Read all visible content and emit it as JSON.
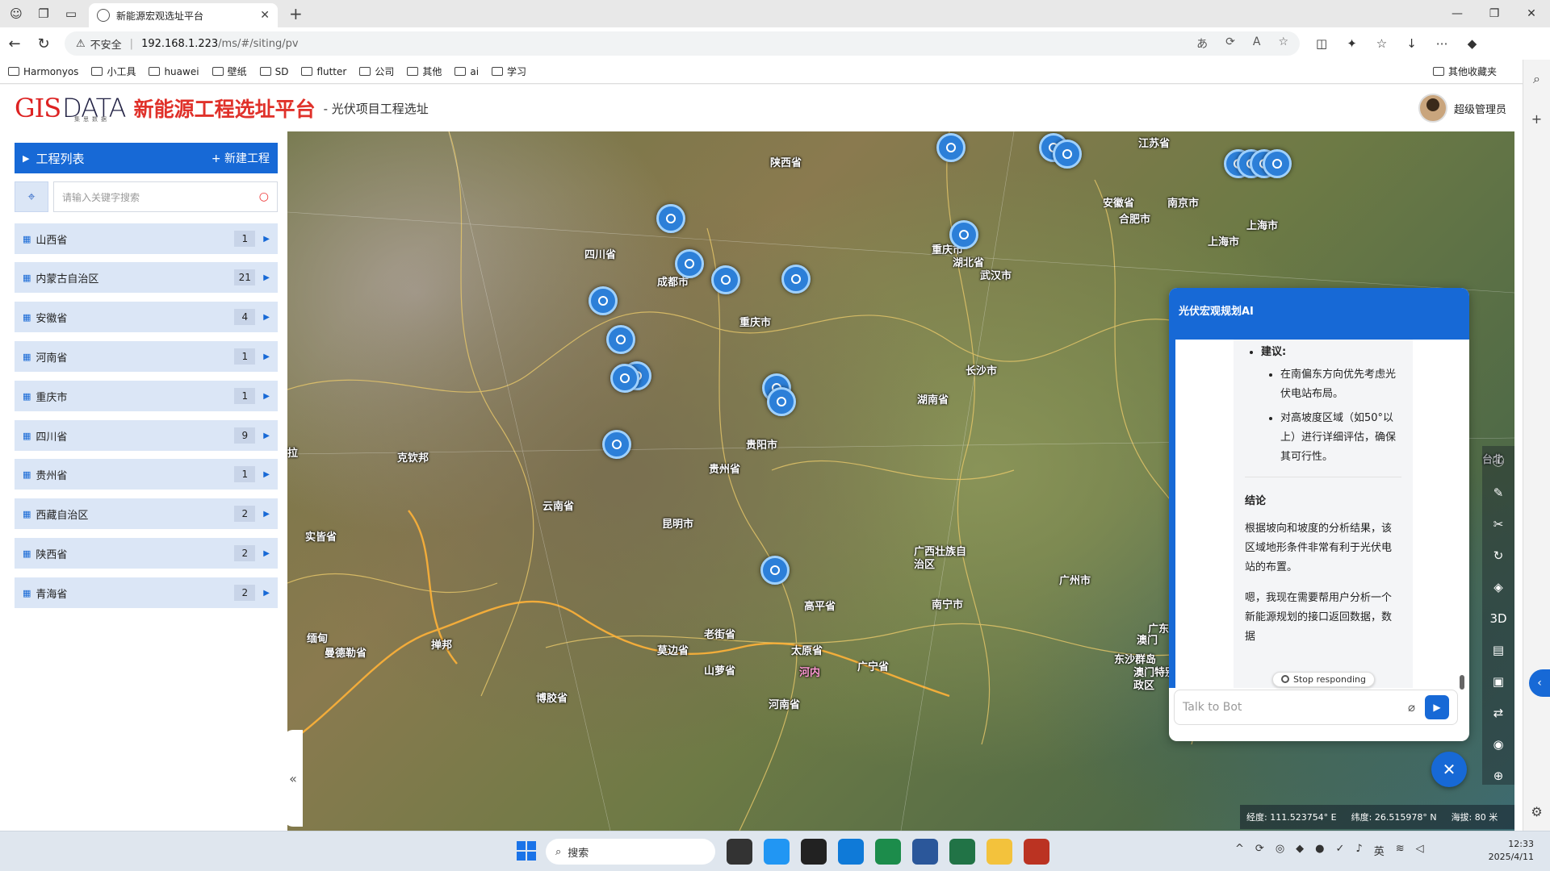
{
  "browser": {
    "tab_title": "新能源宏观选址平台",
    "security_label": "不安全",
    "url_host": "192.168.1.223",
    "url_path": "/ms/#/siting/pv",
    "bookmarks": [
      "Harmonyos",
      "小工具",
      "huawei",
      "壁纸",
      "SD",
      "flutter",
      "公司",
      "其他",
      "ai",
      "学习"
    ],
    "other_bookmarks": "其他收藏夹"
  },
  "header": {
    "logo_gis": "GIS",
    "logo_data": "DATA",
    "logo_sub": "集思数据",
    "platform_title": "新能源工程选址平台",
    "subtitle": "- 光伏项目工程选址",
    "user_name": "超级管理员"
  },
  "sidebar": {
    "list_title": "工程列表",
    "new_project": "+ 新建工程",
    "search_placeholder": "请输入关键字搜索",
    "provinces": [
      {
        "name": "山西省",
        "count": "1"
      },
      {
        "name": "内蒙古自治区",
        "count": "21"
      },
      {
        "name": "安徽省",
        "count": "4"
      },
      {
        "name": "河南省",
        "count": "1"
      },
      {
        "name": "重庆市",
        "count": "1"
      },
      {
        "name": "四川省",
        "count": "9"
      },
      {
        "name": "贵州省",
        "count": "1"
      },
      {
        "name": "西藏自治区",
        "count": "2"
      },
      {
        "name": "陕西省",
        "count": "2"
      },
      {
        "name": "青海省",
        "count": "2"
      }
    ]
  },
  "map": {
    "labels": [
      "陕西省",
      "河",
      "江苏省",
      "安徽省",
      "南京市",
      "合肥市",
      "上海市",
      "上海市",
      "湖北省",
      "武汉市",
      "重庆市",
      "四川省",
      "成都市",
      "重庆市",
      "长沙市",
      "湖南省",
      "贵阳市",
      "贵州省",
      "克钦邦",
      "云南省",
      "昆明市",
      "实皆省",
      "广西壮族自治区",
      "广州市",
      "南宁市",
      "广东",
      "澳门",
      "高平省",
      "老街省",
      "河内",
      "莫边省",
      "太原省",
      "山萝省",
      "广宁省",
      "掸邦",
      "曼德勒省",
      "博胶省",
      "河南省",
      "东沙群岛",
      "澳门特别行政区",
      "拉",
      "台北",
      "缅甸"
    ],
    "coords": {
      "lon": "经度: 111.523754° E",
      "lat": "纬度: 26.515978° N",
      "alt": "海拔: 80 米"
    },
    "tools": [
      "info-icon",
      "ruler-icon",
      "area-icon",
      "refresh-icon",
      "layers-icon",
      "3D",
      "chart-icon",
      "image-icon",
      "swap-icon",
      "compass-icon",
      "globe-icon"
    ]
  },
  "chat": {
    "title": "光伏宏观规划AI",
    "suggestion_heading": "建议:",
    "suggestions": [
      "在南偏东方向优先考虑光伏电站布局。",
      "对高坡度区域（如50°以上）进行详细评估，确保其可行性。"
    ],
    "conclusion_heading": "结论",
    "conclusion_text": "根据坡向和坡度的分析结果，该区域地形条件非常有利于光伏电站的布置。",
    "followup_text": "嗯，我现在需要帮用户分析一个新能源规划的接口返回数据，",
    "followup_tail": "数据",
    "stop_label": "Stop responding",
    "input_placeholder": "Talk to Bot"
  },
  "taskbar": {
    "search_label": "搜索",
    "ime": "英",
    "time": "12:33",
    "date": "2025/4/11"
  }
}
